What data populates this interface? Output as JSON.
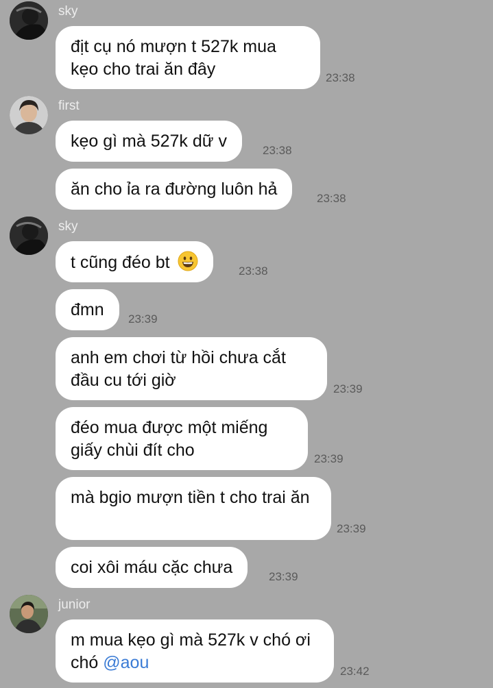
{
  "messages": [
    {
      "sender": "sky",
      "text": "địt cụ nó mượn t 527k mua\nkẹo cho trai ăn đây",
      "time": "23:38"
    },
    {
      "sender": "first",
      "text": "kẹo gì mà 527k dữ v",
      "time": "23:38"
    },
    {
      "text": "ăn cho ỉa ra đường luôn hả",
      "time": "23:38"
    },
    {
      "sender": "sky",
      "text": "t cũng đéo bt",
      "emoji": "grinning-face",
      "time": "23:38"
    },
    {
      "text": "đmn",
      "time": "23:39"
    },
    {
      "text": "anh em chơi từ hồi chưa cắt đầu cu tới giờ",
      "time": "23:39"
    },
    {
      "text": "đéo mua được một miếng giấy chùi đít cho",
      "time": "23:39"
    },
    {
      "text": "mà bgio mượn tiền t cho trai ăn",
      "time": "23:39"
    },
    {
      "text": "coi xôi máu cặc chưa",
      "time": "23:39"
    },
    {
      "sender": "junior",
      "text": "m mua kẹo gì mà 527k v chó ơi chó",
      "mention": "@aou",
      "time": "23:42"
    }
  ],
  "colors": {
    "background": "#a8a8a8",
    "bubble": "#ffffff",
    "mention": "#3a7bd5"
  }
}
